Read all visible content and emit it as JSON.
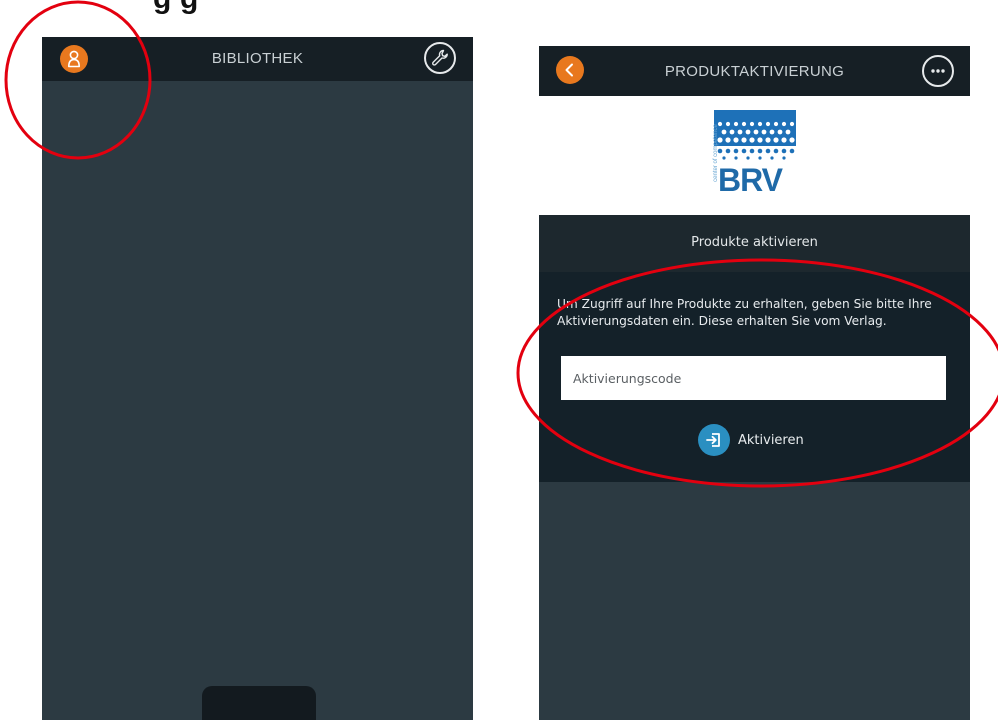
{
  "heading_fragment": "g         g",
  "left_screen": {
    "title": "BIBLIOTHEK",
    "left_button_icon": "user-icon",
    "right_button_icon": "wrench-icon"
  },
  "right_screen": {
    "title": "PRODUKTAKTIVIERUNG",
    "left_button_icon": "back-chevron-icon",
    "right_button_icon": "more-dots-icon",
    "logo": {
      "text": "BRV",
      "side_text": "center of competence"
    },
    "section_title": "Produkte aktivieren",
    "instructions": "Um Zugriff auf Ihre Produkte zu erhalten, geben Sie bitte Ihre Aktivierungsdaten ein. Diese erhalten Sie vom Verlag.",
    "code_input": {
      "placeholder": "Aktivierungscode",
      "value": ""
    },
    "activate_button": {
      "label": "Aktivieren",
      "icon": "login-arrow-icon"
    }
  },
  "colors": {
    "accent_orange": "#e8781e",
    "topbar": "#161f25",
    "background": "#2c3a42",
    "panel": "#142129",
    "activate_blue": "#2a8fc1",
    "annotation_red": "#e3000f",
    "brand_blue": "#1f6aa8"
  }
}
